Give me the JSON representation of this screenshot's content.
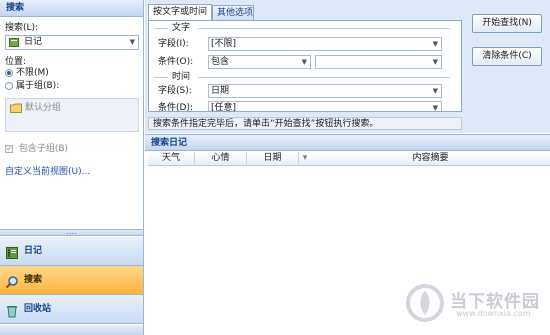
{
  "left_pane": {
    "title": "搜索",
    "search_label": "搜索(L):",
    "search_value": "日记",
    "location_label": "位置:",
    "radio_unlimited": "不限(M)",
    "radio_group": "属于组(B):",
    "default_group": "默认分组",
    "include_subgroups": "包含子组(B)",
    "custom_view_link": "自定义当前视图(U)...",
    "splitter_grip": "....",
    "nav": [
      {
        "label": "日记",
        "icon": "diary-icon",
        "active": false
      },
      {
        "label": "搜索",
        "icon": "search-icon",
        "active": true
      },
      {
        "label": "回收站",
        "icon": "recycle-bin-icon",
        "active": false
      }
    ]
  },
  "tabs": [
    {
      "label": "按文字或时间",
      "active": true
    },
    {
      "label": "其他选项",
      "active": false
    }
  ],
  "text_section": {
    "title": "文字",
    "field_label": "字段(I):",
    "field_value": "[不限]",
    "condition_label": "条件(O):",
    "condition_value": "包含",
    "condition_text": ""
  },
  "time_section": {
    "title": "时间",
    "field_label": "字段(S):",
    "field_value": "日期",
    "condition_label": "条件(D):",
    "condition_value": "[任意]"
  },
  "buttons": {
    "start_search": "开始查找(N)",
    "clear_conditions": "清除条件(C)"
  },
  "hint": "搜索条件指定完毕后，请单击“开始查找”按钮执行搜索。",
  "results": {
    "title": "搜索日记",
    "columns": [
      "天气",
      "心情",
      "日期",
      "内容摘要"
    ]
  },
  "watermark": {
    "text": "当下软件园",
    "url": "www.downxia.com"
  },
  "colors": {
    "accent": "#15428b",
    "active_nav": "#ffb23b",
    "header_bg": "#c3d6ef",
    "panel_bg": "#dfe8f6"
  }
}
